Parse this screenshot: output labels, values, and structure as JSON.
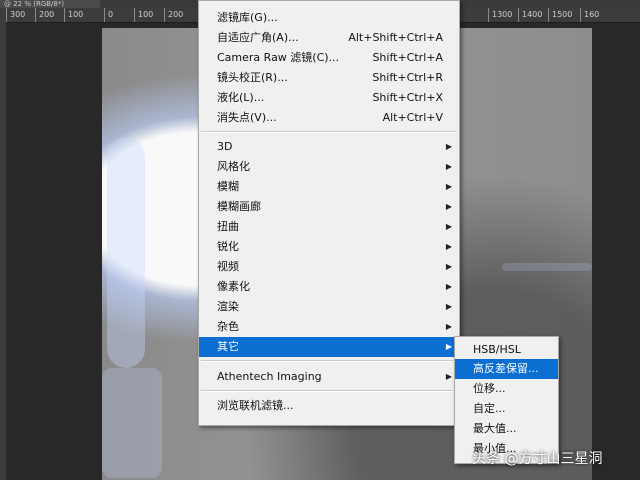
{
  "document_tab": "@ 22 % (RGB/8*)",
  "ruler": {
    "ticks": [
      "300",
      "200",
      "100",
      "0",
      "100",
      "200",
      "1300",
      "1400",
      "1500",
      "160"
    ]
  },
  "filter_menu": {
    "recent": [
      {
        "label": "滤镜库(G)...",
        "shortcut": ""
      },
      {
        "label": "自适应广角(A)...",
        "shortcut": "Alt+Shift+Ctrl+A"
      },
      {
        "label": "Camera Raw 滤镜(C)...",
        "shortcut": "Shift+Ctrl+A"
      },
      {
        "label": "镜头校正(R)...",
        "shortcut": "Shift+Ctrl+R"
      },
      {
        "label": "液化(L)...",
        "shortcut": "Shift+Ctrl+X"
      },
      {
        "label": "消失点(V)...",
        "shortcut": "Alt+Ctrl+V"
      }
    ],
    "groups": [
      "3D",
      "风格化",
      "模糊",
      "模糊画廊",
      "扭曲",
      "锐化",
      "视频",
      "像素化",
      "渲染",
      "杂色",
      "其它"
    ],
    "highlighted_group": "其它",
    "plugins": [
      "Athentech Imaging"
    ],
    "browse": "浏览联机滤镜..."
  },
  "other_submenu": {
    "items": [
      "HSB/HSL",
      "高反差保留...",
      "位移...",
      "自定...",
      "最大值...",
      "最小值..."
    ],
    "highlighted": "高反差保留..."
  },
  "watermark": "头条 @方寸山三星洞",
  "colors": {
    "highlight": "#0a6fd1",
    "menu_bg": "#f0f0f0",
    "workspace": "#282828"
  }
}
